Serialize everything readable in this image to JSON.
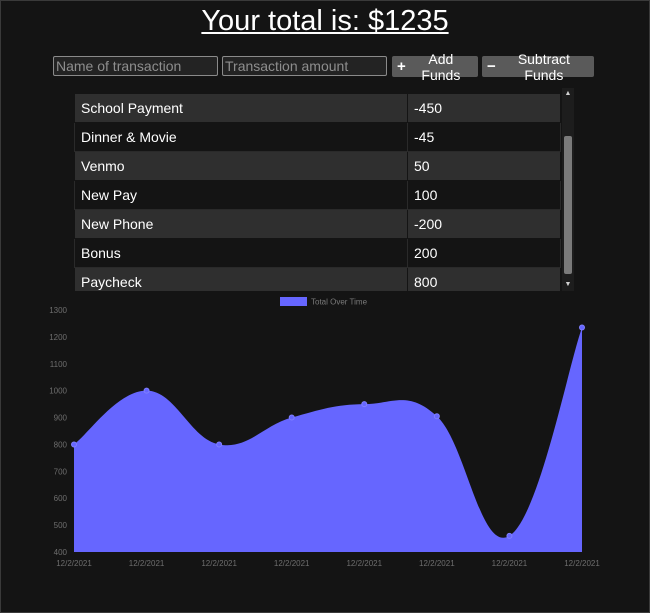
{
  "header": {
    "total_text": "Your total is: $1235"
  },
  "form": {
    "name_placeholder": "Name of transaction",
    "amount_placeholder": "Transaction amount",
    "add_label": "Add Funds",
    "subtract_label": "Subtract Funds"
  },
  "transactions": [
    {
      "name": "School Payment",
      "amount": "-450"
    },
    {
      "name": "Dinner & Movie",
      "amount": "-45"
    },
    {
      "name": "Venmo",
      "amount": "50"
    },
    {
      "name": "New Pay",
      "amount": "100"
    },
    {
      "name": "New Phone",
      "amount": "-200"
    },
    {
      "name": "Bonus",
      "amount": "200"
    },
    {
      "name": "Paycheck",
      "amount": "800"
    }
  ],
  "colors": {
    "series": "#6666ff",
    "background": "#141414",
    "row_alt": "#2f2f2f"
  },
  "chart_data": {
    "type": "area",
    "x": [
      "12/2/2021",
      "12/2/2021",
      "12/2/2021",
      "12/2/2021",
      "12/2/2021",
      "12/2/2021",
      "12/2/2021",
      "12/2/2021"
    ],
    "series": [
      {
        "name": "Total Over Time",
        "values": [
          800,
          1000,
          800,
          900,
          950,
          905,
          460,
          1235
        ]
      }
    ],
    "ylim": [
      400,
      1300
    ],
    "yticks": [
      400,
      500,
      600,
      700,
      800,
      900,
      1000,
      1100,
      1200,
      1300
    ],
    "legend": "top-center",
    "grid": false
  }
}
